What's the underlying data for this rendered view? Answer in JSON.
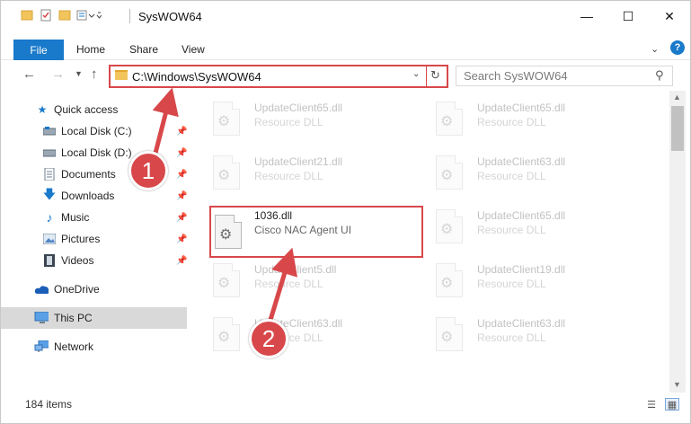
{
  "window": {
    "title": "SysWOW64",
    "minimize_icon": "minimize-icon",
    "maximize_icon": "maximize-icon",
    "close_icon": "close-icon"
  },
  "ribbon": {
    "tabs": [
      "File",
      "Home",
      "Share",
      "View"
    ]
  },
  "nav": {
    "address": "C:\\Windows\\SysWOW64",
    "search_placeholder": "Search SysWOW64"
  },
  "sidebar": {
    "items": [
      {
        "label": "Quick access",
        "icon": "star-icon",
        "pinned": false
      },
      {
        "label": "Local Disk (C:)",
        "icon": "drive-icon",
        "pinned": true
      },
      {
        "label": "Local Disk (D:)",
        "icon": "drive-icon",
        "pinned": true
      },
      {
        "label": "Documents",
        "icon": "documents-icon",
        "pinned": true
      },
      {
        "label": "Downloads",
        "icon": "download-icon",
        "pinned": true
      },
      {
        "label": "Music",
        "icon": "music-icon",
        "pinned": true
      },
      {
        "label": "Pictures",
        "icon": "pictures-icon",
        "pinned": true
      },
      {
        "label": "Videos",
        "icon": "videos-icon",
        "pinned": true
      },
      {
        "label": "OneDrive",
        "icon": "cloud-icon",
        "pinned": false
      },
      {
        "label": "This PC",
        "icon": "computer-icon",
        "pinned": false,
        "selected": true
      },
      {
        "label": "Network",
        "icon": "network-icon",
        "pinned": false
      }
    ]
  },
  "files": [
    {
      "name": "UpdateClient65.dll",
      "desc": "Resource DLL"
    },
    {
      "name": "UpdateClient65.dll",
      "desc": "Resource DLL"
    },
    {
      "name": "UpdateClient21.dll",
      "desc": "Resource DLL"
    },
    {
      "name": "UpdateClient63.dll",
      "desc": "Resource DLL"
    },
    {
      "name": "1036.dll",
      "desc": "Cisco NAC Agent UI"
    },
    {
      "name": "UpdateClient65.dll",
      "desc": "Resource DLL"
    },
    {
      "name": "UpdateClient5.dll",
      "desc": "Resource DLL"
    },
    {
      "name": "UpdateClient19.dll",
      "desc": "Resource DLL"
    },
    {
      "name": "UpdateClient63.dll",
      "desc": "Resource DLL"
    },
    {
      "name": "UpdateClient63.dll",
      "desc": "Resource DLL"
    }
  ],
  "status": {
    "count": "184 items"
  },
  "annotations": {
    "step1": "1",
    "step2": "2",
    "color": "#d8484a"
  }
}
